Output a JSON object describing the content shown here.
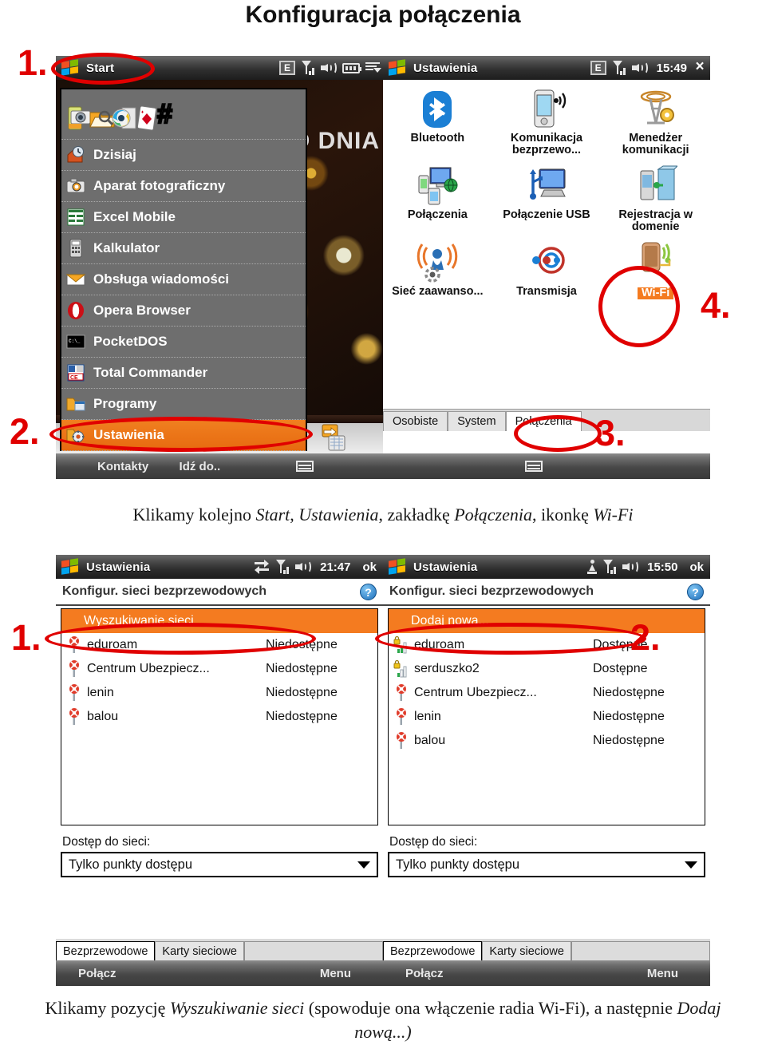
{
  "doc": {
    "title": "Konfiguracja połączenia",
    "caption_1": {
      "prefix": "Klikamy kolejno ",
      "i1": "Start",
      "mid1": ", ",
      "i2": "Ustawienia",
      "mid2": ", zakładkę ",
      "i3": "Połączenia",
      "mid3": ", ikonkę ",
      "i4": "Wi-Fi"
    },
    "caption_2": {
      "prefix": "Klikamy pozycję ",
      "i1": "Wyszukiwanie sieci",
      "mid1": " (spowoduje ona włączenie radia Wi-Fi), a następnie ",
      "i2": "Dodaj nową...)"
    }
  },
  "annotations": {
    "n1": "1.",
    "n2": "2.",
    "n3": "3.",
    "n4": "4.",
    "n1b": "1.",
    "n2b": "2.",
    "color": "#e00000"
  },
  "start_screen": {
    "statusbar": {
      "start_label": "Start",
      "icons": [
        "e-icon",
        "signal-icon",
        "speaker-icon",
        "battery-icon",
        "menu-icon"
      ]
    },
    "wallpaper_text": "D DNIA",
    "pinned_icons": [
      "camera-icon",
      "file-explorer-icon",
      "media-player-icon",
      "solitaire-icon",
      "hash-icon"
    ],
    "menu_items": [
      {
        "label": "Dzisiaj",
        "icon": "home-clock-icon",
        "selected": false
      },
      {
        "label": "Aparat fotograficzny",
        "icon": "camera-icon",
        "selected": false
      },
      {
        "label": "Excel Mobile",
        "icon": "excel-icon",
        "selected": false
      },
      {
        "label": "Kalkulator",
        "icon": "calculator-icon",
        "selected": false
      },
      {
        "label": "Obsługa wiadomości",
        "icon": "envelope-icon",
        "selected": false
      },
      {
        "label": "Opera Browser",
        "icon": "opera-icon",
        "selected": false
      },
      {
        "label": "PocketDOS",
        "icon": "dos-prompt-icon",
        "selected": false
      },
      {
        "label": "Total Commander",
        "icon": "total-commander-icon",
        "selected": false
      },
      {
        "label": "Programy",
        "icon": "folder-icon",
        "selected": false
      },
      {
        "label": "Ustawienia",
        "icon": "gear-folder-icon",
        "selected": true
      }
    ],
    "softkeys": {
      "left": "Kontakty",
      "center": "Idź do..",
      "right": ""
    }
  },
  "settings_screen": {
    "statusbar": {
      "title": "Ustawienia",
      "clock": "15:49",
      "close": "×",
      "icons": [
        "e-icon",
        "signal-icon",
        "speaker-icon"
      ]
    },
    "items": [
      {
        "label": "Bluetooth",
        "icon": "bluetooth-icon"
      },
      {
        "label": "Komunikacja bezprzewo...",
        "icon": "wireless-comm-icon"
      },
      {
        "label": "Menedżer komunikacji",
        "icon": "comm-manager-icon"
      },
      {
        "label": "Połączenia",
        "icon": "connections-icon"
      },
      {
        "label": "Połączenie USB",
        "icon": "usb-connection-icon"
      },
      {
        "label": "Rejestracja w domenie",
        "icon": "domain-enroll-icon"
      },
      {
        "label": "Sieć zaawanso...",
        "icon": "advanced-network-icon"
      },
      {
        "label": "Transmisja",
        "icon": "beam-icon"
      },
      {
        "label": "Wi-Fi",
        "icon": "wifi-icon"
      }
    ],
    "tabs": [
      {
        "label": "Osobiste",
        "active": false
      },
      {
        "label": "System",
        "active": false
      },
      {
        "label": "Połączenia",
        "active": true
      }
    ]
  },
  "wifi_left": {
    "statusbar": {
      "title": "Ustawienia",
      "clock": "21:47",
      "ok": "ok",
      "icons": [
        "sync-icon",
        "signal-icon",
        "speaker-icon"
      ]
    },
    "header": "Konfigur. sieci bezprzewodowych",
    "help_icon": "?",
    "list": [
      {
        "name": "Wyszukiwanie sieci",
        "status": "",
        "icon": "",
        "selected": true
      },
      {
        "name": "eduroam",
        "status": "Niedostępne",
        "icon": "unavailable-network-icon",
        "selected": false
      },
      {
        "name": "Centrum Ubezpiecz...",
        "status": "Niedostępne",
        "icon": "unavailable-network-icon",
        "selected": false
      },
      {
        "name": "lenin",
        "status": "Niedostępne",
        "icon": "unavailable-network-icon",
        "selected": false
      },
      {
        "name": "balou",
        "status": "Niedostępne",
        "icon": "unavailable-network-icon",
        "selected": false
      }
    ],
    "access_label": "Dostęp do sieci:",
    "access_value": "Tylko punkty dostępu",
    "tabs": [
      {
        "label": "Bezprzewodowe",
        "active": true
      },
      {
        "label": "Karty sieciowe",
        "active": false
      }
    ],
    "softkeys": {
      "left": "Połącz",
      "right": "Menu"
    }
  },
  "wifi_right": {
    "statusbar": {
      "title": "Ustawienia",
      "clock": "15:50",
      "ok": "ok",
      "icons": [
        "person-icon",
        "signal-icon",
        "speaker-icon"
      ]
    },
    "header": "Konfigur. sieci bezprzewodowych",
    "help_icon": "?",
    "list": [
      {
        "name": "Dodaj nową...",
        "status": "",
        "icon": "",
        "selected": true
      },
      {
        "name": "eduroam",
        "status": "Dostępne",
        "icon": "secure-available-network-icon",
        "selected": false
      },
      {
        "name": "serduszko2",
        "status": "Dostępne",
        "icon": "secure-available-network-icon",
        "selected": false
      },
      {
        "name": "Centrum Ubezpiecz...",
        "status": "Niedostępne",
        "icon": "unavailable-network-icon",
        "selected": false
      },
      {
        "name": "lenin",
        "status": "Niedostępne",
        "icon": "unavailable-network-icon",
        "selected": false
      },
      {
        "name": "balou",
        "status": "Niedostępne",
        "icon": "unavailable-network-icon",
        "selected": false
      }
    ],
    "access_label": "Dostęp do sieci:",
    "access_value": "Tylko punkty dostępu",
    "tabs": [
      {
        "label": "Bezprzewodowe",
        "active": true
      },
      {
        "label": "Karty sieciowe",
        "active": false
      }
    ],
    "softkeys": {
      "left": "Połącz",
      "right": "Menu"
    }
  }
}
